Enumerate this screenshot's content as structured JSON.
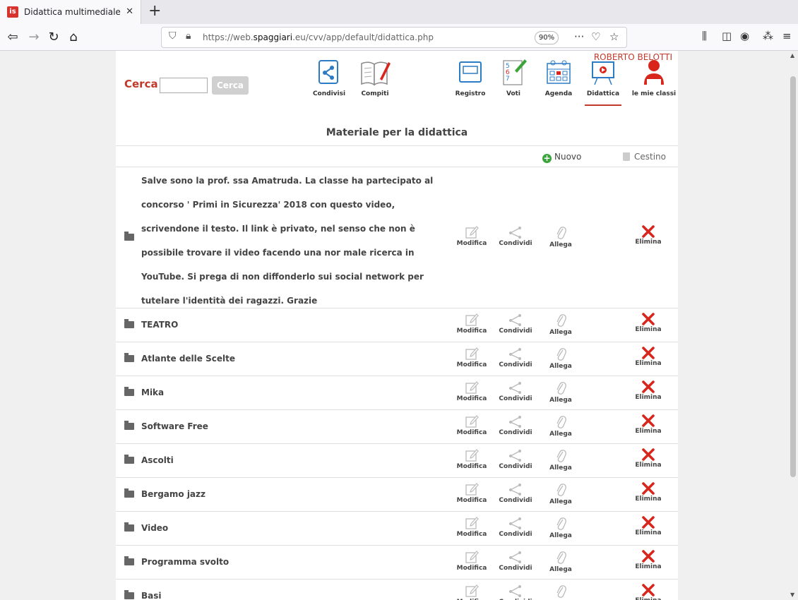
{
  "browser": {
    "tab_title": "Didattica multimediale",
    "tab_favicon": "is",
    "new_tab": "+",
    "url_host_prefix": "https://web.",
    "url_host_bold": "spaggiari",
    "url_rest": ".eu/cvv/app/default/didattica.php",
    "zoom": "90%"
  },
  "header": {
    "user_name": "ROBERTO BELOTTI",
    "search_label": "Cerca",
    "search_value": "",
    "search_button": "Cerca"
  },
  "menu": [
    {
      "label": "Condivisi",
      "icon": "share-folder-icon"
    },
    {
      "label": "Compiti",
      "icon": "notebook-pen-icon"
    },
    {
      "label": "Registro",
      "icon": "register-icon"
    },
    {
      "label": "Voti",
      "icon": "grades-icon"
    },
    {
      "label": "Agenda",
      "icon": "calendar-icon"
    },
    {
      "label": "Didattica",
      "icon": "presentation-icon",
      "active": true
    },
    {
      "label": "le mie classi",
      "icon": "person-icon"
    }
  ],
  "section": {
    "title": "Materiale per la didattica",
    "new_label": "Nuovo",
    "trash_label": "Cestino"
  },
  "actions": {
    "edit": "Modifica",
    "share": "Condividi",
    "attach": "Allega",
    "delete": "Elimina"
  },
  "folders": [
    {
      "title": "Salve sono la prof. ssa Amatruda. La classe ha partecipato al concorso ' Primi in Sicurezza' 2018 con questo video, scrivendone il testo. Il link è privato, nel senso che non è possibile trovare il video facendo una nor male ricerca in YouTube. Si prega di non diffonderlo sui social network per tutelare l'identità dei ragazzi. Grazie"
    },
    {
      "title": "TEATRO"
    },
    {
      "title": "Atlante delle Scelte"
    },
    {
      "title": "Mika"
    },
    {
      "title": "Software Free"
    },
    {
      "title": "Ascolti"
    },
    {
      "title": "Bergamo jazz"
    },
    {
      "title": "Video"
    },
    {
      "title": "Programma svolto"
    },
    {
      "title": "Basi"
    }
  ],
  "colors": {
    "accent": "#c0392b",
    "delete": "#d9261c",
    "new": "#3aa43a"
  }
}
